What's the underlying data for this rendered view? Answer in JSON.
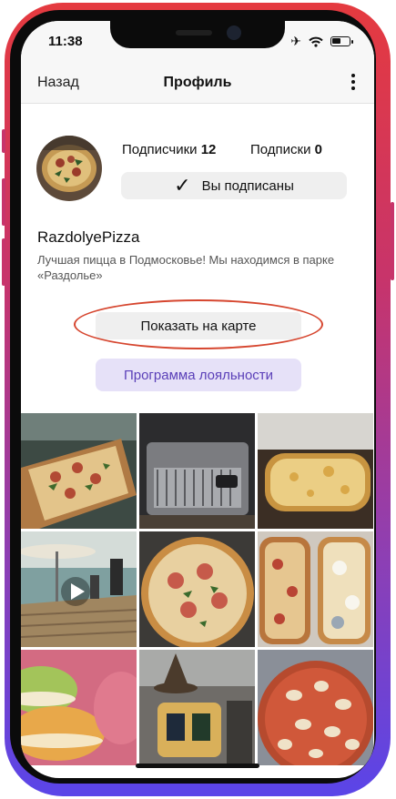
{
  "status": {
    "time": "11:38"
  },
  "nav": {
    "back": "Назад",
    "title": "Профиль"
  },
  "profile": {
    "followers_label": "Подписчики",
    "followers_count": "12",
    "following_label": "Подписки",
    "following_count": "0",
    "subscribed_label": "Вы подписаны",
    "name": "RazdolyePizza",
    "description": "Лучшая пицца в Подмосковье! Мы находимся в парке «Раздолье»"
  },
  "buttons": {
    "show_on_map": "Показать на карте",
    "loyalty": "Программа лояльности"
  },
  "photos": [
    {
      "subject": "pizza-photo"
    },
    {
      "subject": "coffee-machine-photo"
    },
    {
      "subject": "cheese-pizza-photo"
    },
    {
      "subject": "video-photo"
    },
    {
      "subject": "salami-pizza-photo"
    },
    {
      "subject": "pizza-slices-photo"
    },
    {
      "subject": "macarons-photo"
    },
    {
      "subject": "cafe-decor-photo"
    },
    {
      "subject": "mushroom-pizza-photo"
    }
  ],
  "colors": {
    "frame_top": "#e53a3f",
    "frame_bottom": "#5a45e8",
    "loyalty_bg": "#e6e1f8",
    "loyalty_text": "#5a3fb8",
    "annotation": "#d6462f"
  }
}
